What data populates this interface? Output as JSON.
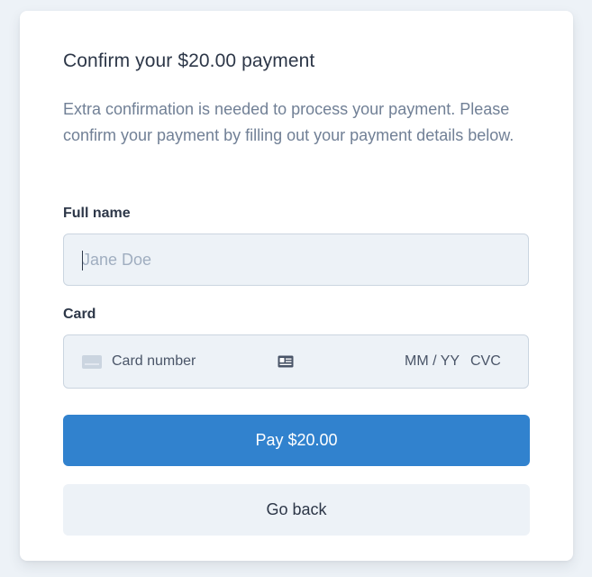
{
  "dialog": {
    "title": "Confirm your $20.00 payment",
    "description": "Extra confirmation is needed to process your payment. Please confirm your payment by filling out your payment details below."
  },
  "form": {
    "full_name": {
      "label": "Full name",
      "placeholder": "Jane Doe",
      "value": ""
    },
    "card": {
      "label": "Card",
      "number_placeholder": "Card number",
      "expiry_placeholder": "MM / YY",
      "cvc_placeholder": "CVC"
    }
  },
  "actions": {
    "pay_label": "Pay $20.00",
    "back_label": "Go back"
  },
  "colors": {
    "primary": "#3182ce",
    "background": "#edf2f7",
    "text": "#2d3748",
    "muted": "#718096"
  }
}
